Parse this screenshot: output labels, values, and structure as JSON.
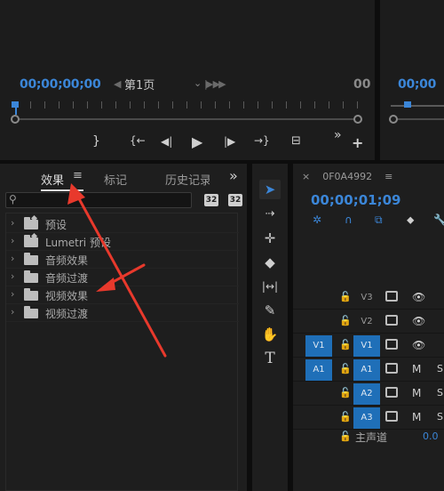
{
  "source_monitor": {
    "timecode": "00;00;00;00",
    "page_label": "第1页",
    "end_timecode_partial": "00"
  },
  "program_monitor": {
    "timecode_partial": "00;00"
  },
  "transport": {
    "mark_out": "}",
    "step_back_marker": "{←",
    "step_back": "◀|",
    "play": "▶",
    "step_forward": "|▶",
    "go_to_out": "→}",
    "overflow": "»",
    "add": "+"
  },
  "effects_panel": {
    "tabs": [
      {
        "label": "效果",
        "active": true
      },
      {
        "label": "标记",
        "active": false
      },
      {
        "label": "历史记录",
        "active": false
      }
    ],
    "menu_icon": "≡",
    "overflow": "»",
    "search": {
      "value": "",
      "placeholder": ""
    },
    "buttons": {
      "accelerated": "32",
      "yuv": "32"
    },
    "tree": [
      {
        "label": "预设"
      },
      {
        "label": "Lumetri 预设"
      },
      {
        "label": "音频效果"
      },
      {
        "label": "音频过渡"
      },
      {
        "label": "视频效果"
      },
      {
        "label": "视频过渡"
      }
    ]
  },
  "tools": [
    "selection-tool",
    "track-select-tool",
    "ripple-edit-tool",
    "razor-tool",
    "slip-tool",
    "pen-tool",
    "hand-tool",
    "type-tool"
  ],
  "timeline": {
    "close": "×",
    "sequence_name": "0F0A4992",
    "menu_icon": "≡",
    "timecode": "00;00;01;09",
    "tracks": [
      {
        "src": "",
        "target": "V3",
        "target_on": false,
        "col2": "eye",
        "col3": ""
      },
      {
        "src": "",
        "target": "V2",
        "target_on": false,
        "col2": "eye",
        "col3": ""
      },
      {
        "src": "V1",
        "target": "V1",
        "target_on": true,
        "col2": "eye",
        "col3": ""
      },
      {
        "src": "A1",
        "target": "A1",
        "target_on": true,
        "col2": "M",
        "col3": "S"
      },
      {
        "src": "",
        "target": "A2",
        "target_on": true,
        "col2": "M",
        "col3": "S"
      },
      {
        "src": "",
        "target": "A3",
        "target_on": true,
        "col2": "M",
        "col3": "S"
      }
    ],
    "master_label": "主声道",
    "master_value": "0.0"
  },
  "colors": {
    "accent_blue": "#3b86d8",
    "track_blue": "#1f6fb8",
    "annotation_red": "#e8392c"
  }
}
